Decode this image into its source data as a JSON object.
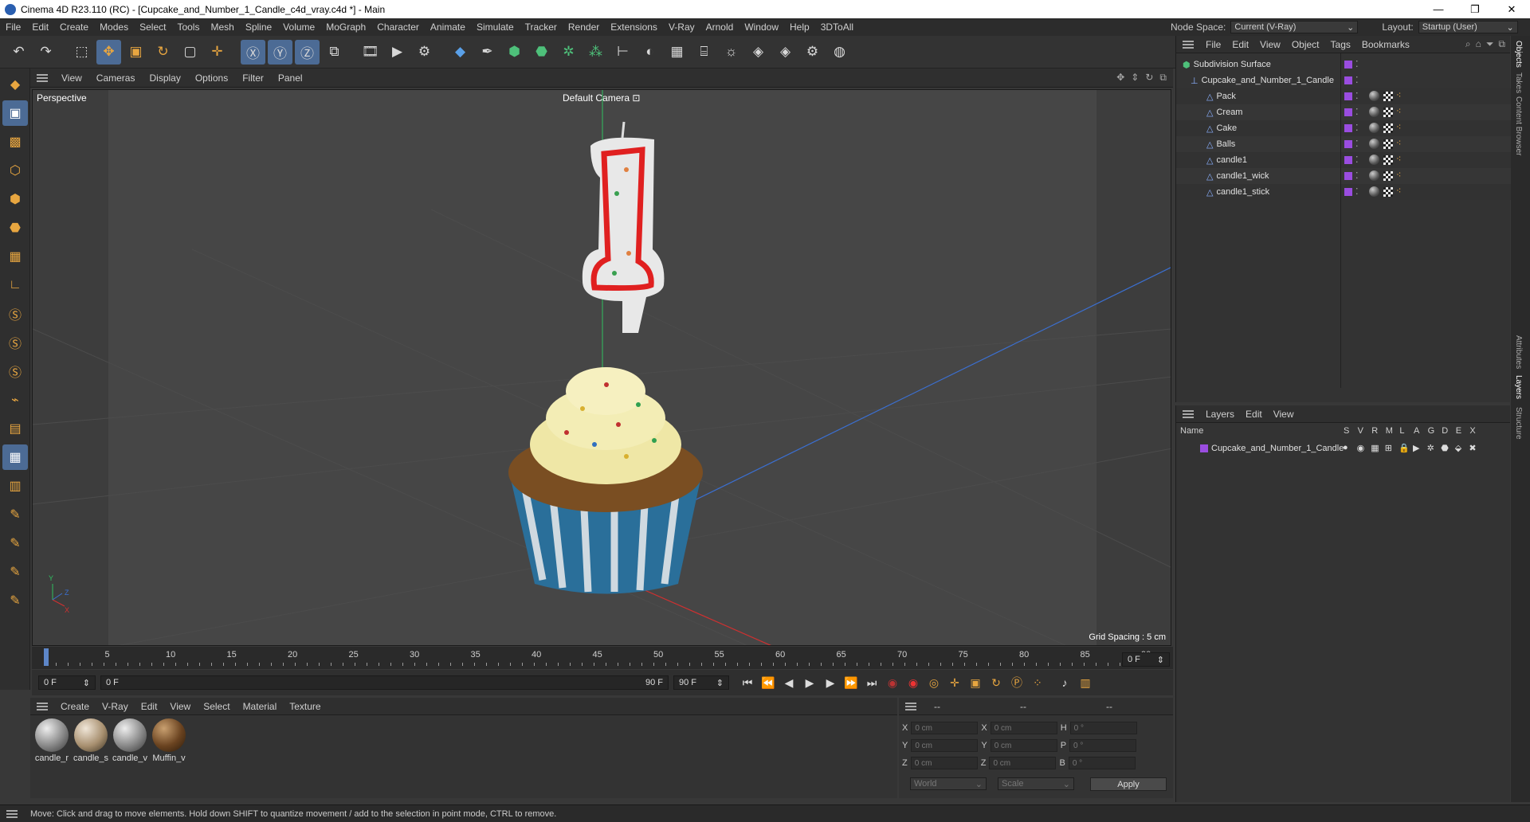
{
  "window": {
    "title": "Cinema 4D R23.110 (RC) - [Cupcake_and_Number_1_Candle_c4d_vray.c4d *] - Main"
  },
  "menubar": {
    "items": [
      "File",
      "Edit",
      "Create",
      "Modes",
      "Select",
      "Tools",
      "Mesh",
      "Spline",
      "Volume",
      "MoGraph",
      "Character",
      "Animate",
      "Simulate",
      "Tracker",
      "Render",
      "Extensions",
      "V-Ray",
      "Arnold",
      "Window",
      "Help",
      "3DToAll"
    ],
    "node_space_label": "Node Space:",
    "node_space_value": "Current (V-Ray)",
    "layout_label": "Layout:",
    "layout_value": "Startup (User)"
  },
  "toolbar": {
    "icons": [
      "undo-icon",
      "redo-icon",
      "sep",
      "live-select-icon",
      "move-icon",
      "scale-icon",
      "rotate-icon",
      "recent-tool-icon",
      "transform-icon",
      "sep",
      "x-axis-icon",
      "y-axis-icon",
      "z-axis-icon",
      "coordinate-system-icon",
      "sep",
      "render-region-icon",
      "render-view-icon",
      "render-settings-icon",
      "sep",
      "cube-icon",
      "pen-icon",
      "subdivision-icon",
      "extrude-icon",
      "cloner-icon",
      "fracture-icon",
      "deformer-icon",
      "field-icon",
      "floor-icon",
      "camera-icon",
      "light-icon",
      "python-icon",
      "python-generator-icon",
      "gear-icon",
      "globe-icon"
    ],
    "labels": {
      "x": "X",
      "y": "Y",
      "z": "Z"
    }
  },
  "viewport": {
    "menu": [
      "View",
      "Cameras",
      "Display",
      "Options",
      "Filter",
      "Panel"
    ],
    "label": "Perspective",
    "camera": "Default Camera",
    "grid_spacing": "Grid Spacing : 5 cm"
  },
  "timeline": {
    "ticks": [
      "0",
      "5",
      "10",
      "15",
      "20",
      "25",
      "30",
      "35",
      "40",
      "45",
      "50",
      "55",
      "60",
      "65",
      "70",
      "75",
      "80",
      "85",
      "90"
    ],
    "current_frame": "0 F"
  },
  "transport": {
    "start": "0 F",
    "range_start": "0 F",
    "range_end": "90 F",
    "end": "90 F"
  },
  "materials": {
    "menu": [
      "Create",
      "V-Ray",
      "Edit",
      "View",
      "Select",
      "Material",
      "Texture"
    ],
    "items": [
      {
        "name": "candle_r"
      },
      {
        "name": "candle_s"
      },
      {
        "name": "candle_v"
      },
      {
        "name": "Muffin_v"
      }
    ]
  },
  "coords": {
    "headers": [
      "--",
      "--",
      "--"
    ],
    "rows": [
      {
        "a": "X",
        "av": "0 cm",
        "b": "X",
        "bv": "0 cm",
        "c": "H",
        "cv": "0 °"
      },
      {
        "a": "Y",
        "av": "0 cm",
        "b": "Y",
        "bv": "0 cm",
        "c": "P",
        "cv": "0 °"
      },
      {
        "a": "Z",
        "av": "0 cm",
        "b": "Z",
        "bv": "0 cm",
        "c": "B",
        "cv": "0 °"
      }
    ],
    "mode": "World",
    "scale": "Scale",
    "apply": "Apply"
  },
  "objects": {
    "menu": [
      "File",
      "Edit",
      "View",
      "Object",
      "Tags",
      "Bookmarks"
    ],
    "tree": [
      {
        "name": "Subdivision Surface",
        "tags": false
      },
      {
        "name": "Cupcake_and_Number_1_Candle",
        "tags": false
      },
      {
        "name": "Pack",
        "tags": true
      },
      {
        "name": "Cream",
        "tags": true
      },
      {
        "name": "Cake",
        "tags": true
      },
      {
        "name": "Balls",
        "tags": true
      },
      {
        "name": "candle1",
        "tags": true
      },
      {
        "name": "candle1_wick",
        "tags": true
      },
      {
        "name": "candle1_stick",
        "tags": true
      }
    ]
  },
  "layers": {
    "menu": [
      "Layers",
      "Edit",
      "View"
    ],
    "col_name": "Name",
    "cols": [
      "S",
      "V",
      "R",
      "M",
      "L",
      "A",
      "G",
      "D",
      "E",
      "X"
    ],
    "items": [
      {
        "name": "Cupcake_and_Number_1_Candle"
      }
    ]
  },
  "right_tabs": [
    "Objects",
    "Takes",
    "Content Browser",
    "Attributes",
    "Layers",
    "Structure"
  ],
  "status": {
    "text": "Move: Click and drag to move elements. Hold down SHIFT to quantize movement / add to the selection in point mode, CTRL to remove."
  },
  "colors": {
    "accent": "#4c6b95",
    "layer": "#9a4de0"
  }
}
